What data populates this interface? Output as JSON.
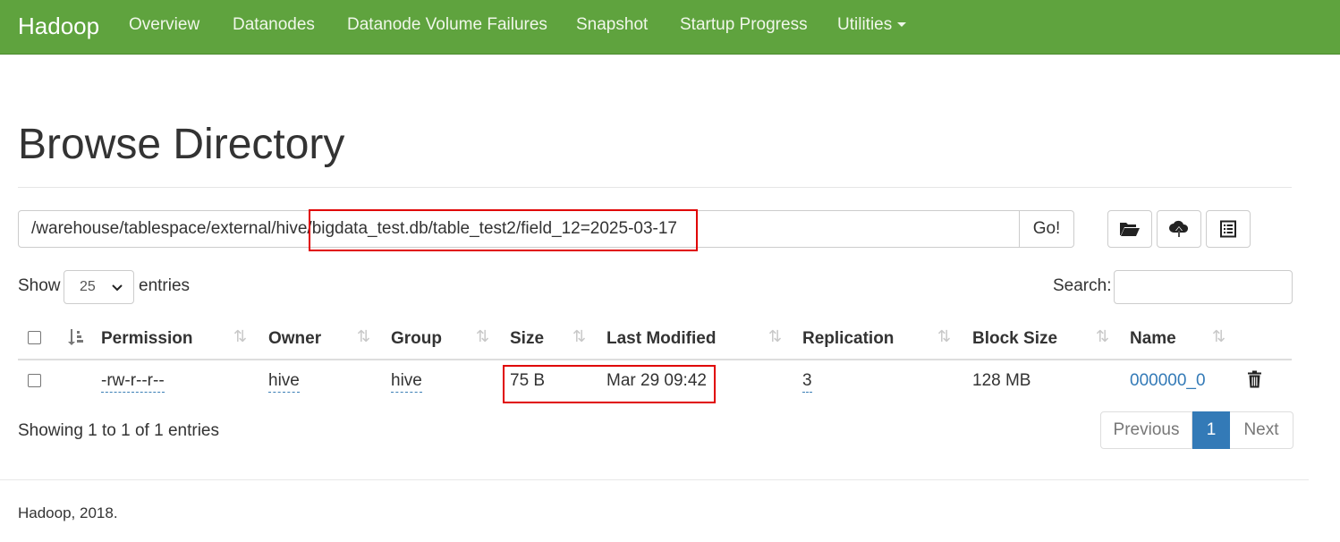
{
  "navbar": {
    "brand": "Hadoop",
    "items": [
      "Overview",
      "Datanodes",
      "Datanode Volume Failures",
      "Snapshot",
      "Startup Progress",
      "Utilities"
    ],
    "bg_color": "#5fa33e"
  },
  "page": {
    "title": "Browse Directory",
    "path_value": "/warehouse/tablespace/external/hive/bigdata_test.db/table_test2/field_12=2025-03-17",
    "go_label": "Go!",
    "icons": [
      "folder-open-icon",
      "cloud-upload-icon",
      "list-icon"
    ]
  },
  "controls": {
    "show_label": "Show",
    "page_size": "25",
    "entries_label": "entries",
    "search_label": "Search:"
  },
  "table": {
    "headers": [
      "Permission",
      "Owner",
      "Group",
      "Size",
      "Last Modified",
      "Replication",
      "Block Size",
      "Name"
    ],
    "rows": [
      {
        "permission": "-rw-r--r--",
        "owner": "hive",
        "group": "hive",
        "size": "75 B",
        "last_modified": "Mar 29 09:42",
        "replication": "3",
        "block_size": "128 MB",
        "name": "000000_0"
      }
    ]
  },
  "pagination": {
    "info": "Showing 1 to 1 of 1 entries",
    "previous": "Previous",
    "current": "1",
    "next": "Next"
  },
  "footer": {
    "text": "Hadoop, 2018."
  },
  "colors": {
    "link": "#337ab7",
    "highlight": "#e00000",
    "active_page": "#337ab7"
  }
}
